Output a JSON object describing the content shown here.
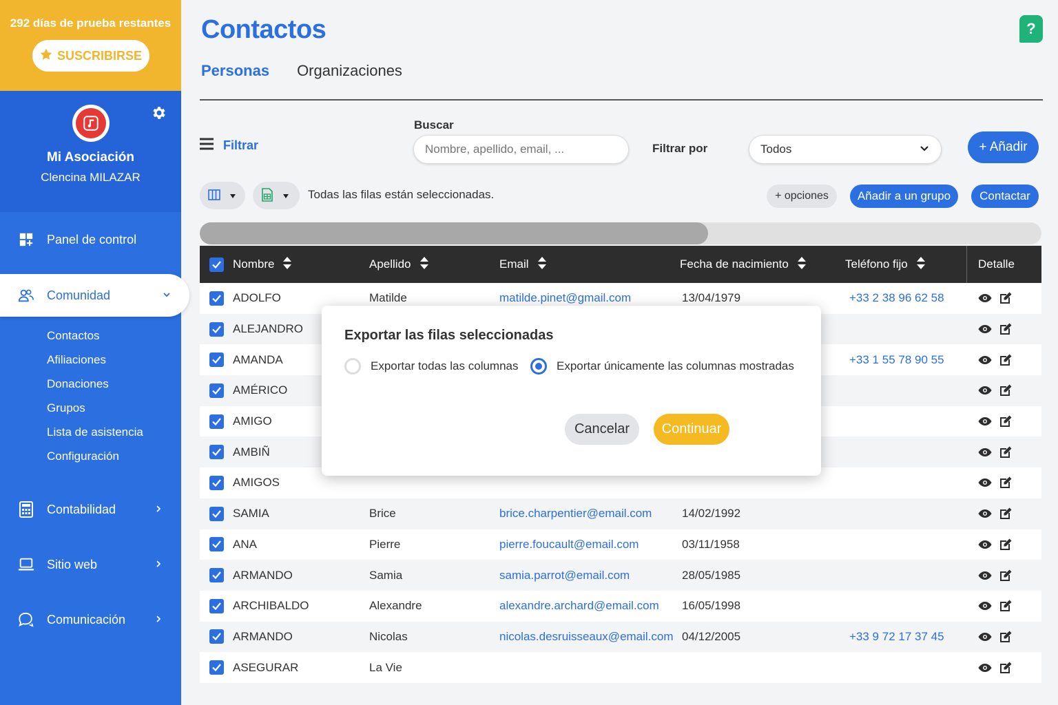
{
  "sidebar": {
    "trial_text": "292 días de prueba restantes",
    "subscribe_label": "SUSCRIBIRSE",
    "org_name": "Mi Asociación",
    "user_name": "Clencina MILAZAR",
    "nav": [
      {
        "label": "Panel de control"
      },
      {
        "label": "Comunidad"
      },
      {
        "label": "Contabilidad"
      },
      {
        "label": "Sitio web"
      },
      {
        "label": "Comunicación"
      }
    ],
    "community_sub": [
      "Contactos",
      "Afiliaciones",
      "Donaciones",
      "Grupos",
      "Lista de asistencia",
      "Configuración"
    ]
  },
  "header": {
    "title": "Contactos",
    "tabs": [
      "Personas",
      "Organizaciones"
    ]
  },
  "filters": {
    "filter_label": "Filtrar",
    "search_label": "Buscar",
    "search_placeholder": "Nombre, apellido, email, ...",
    "filter_by_label": "Filtrar por",
    "filter_by_value": "Todos",
    "add_label": "+ Añadir"
  },
  "toolbar": {
    "status": "Todas las filas están seleccionadas.",
    "options_label": "+ opciones",
    "add_group_label": "Añadir a un grupo",
    "contact_label": "Contactar"
  },
  "table": {
    "headers": [
      "Nombre",
      "Apellido",
      "Email",
      "Fecha de nacimiento",
      "Teléfono fijo",
      "Detalle"
    ],
    "rows": [
      {
        "nombre": "ADOLFO",
        "apellido": "Matilde",
        "email": "matilde.pinet@gmail.com",
        "fecha": "13/04/1979",
        "telefono": "+33 2 38 96 62 58"
      },
      {
        "nombre": "ALEJANDRO",
        "apellido": "",
        "email": "",
        "fecha": "",
        "telefono": ""
      },
      {
        "nombre": "AMANDA",
        "apellido": "",
        "email": "",
        "fecha": "",
        "telefono": "+33 1 55 78 90 55"
      },
      {
        "nombre": "AMÉRICO",
        "apellido": "",
        "email": "",
        "fecha": "",
        "telefono": ""
      },
      {
        "nombre": "AMIGO",
        "apellido": "",
        "email": "",
        "fecha": "",
        "telefono": ""
      },
      {
        "nombre": "AMBIÑ",
        "apellido": "",
        "email": "",
        "fecha": "",
        "telefono": ""
      },
      {
        "nombre": "AMIGOS",
        "apellido": "",
        "email": "",
        "fecha": "",
        "telefono": ""
      },
      {
        "nombre": "SAMIA",
        "apellido": "Brice",
        "email": "brice.charpentier@email.com",
        "fecha": "14/02/1992",
        "telefono": ""
      },
      {
        "nombre": "ANA",
        "apellido": "Pierre",
        "email": "pierre.foucault@email.com",
        "fecha": "03/11/1958",
        "telefono": ""
      },
      {
        "nombre": "ARMANDO",
        "apellido": "Samia",
        "email": "samia.parrot@email.com",
        "fecha": "28/05/1985",
        "telefono": ""
      },
      {
        "nombre": "ARCHIBALDO",
        "apellido": "Alexandre",
        "email": "alexandre.archard@email.com",
        "fecha": "16/05/1998",
        "telefono": ""
      },
      {
        "nombre": "ARMANDO",
        "apellido": "Nicolas",
        "email": "nicolas.desruisseaux@email.com",
        "fecha": "04/12/2005",
        "telefono": "+33 9 72 17 37 45"
      },
      {
        "nombre": "ASEGURAR",
        "apellido": "La Vie",
        "email": "",
        "fecha": "",
        "telefono": ""
      }
    ]
  },
  "modal": {
    "title": "Exportar las filas seleccionadas",
    "option_all": "Exportar todas las columnas",
    "option_shown": "Exportar únicamente las columnas mostradas",
    "selected_option": "shown",
    "cancel_label": "Cancelar",
    "continue_label": "Continuar"
  },
  "help_label": "?",
  "colors": {
    "primary": "#2b6fe0",
    "trial_banner": "#f1b52e",
    "continue": "#f5b921",
    "help": "#1fb37a",
    "table_header": "#2d2d2d"
  }
}
